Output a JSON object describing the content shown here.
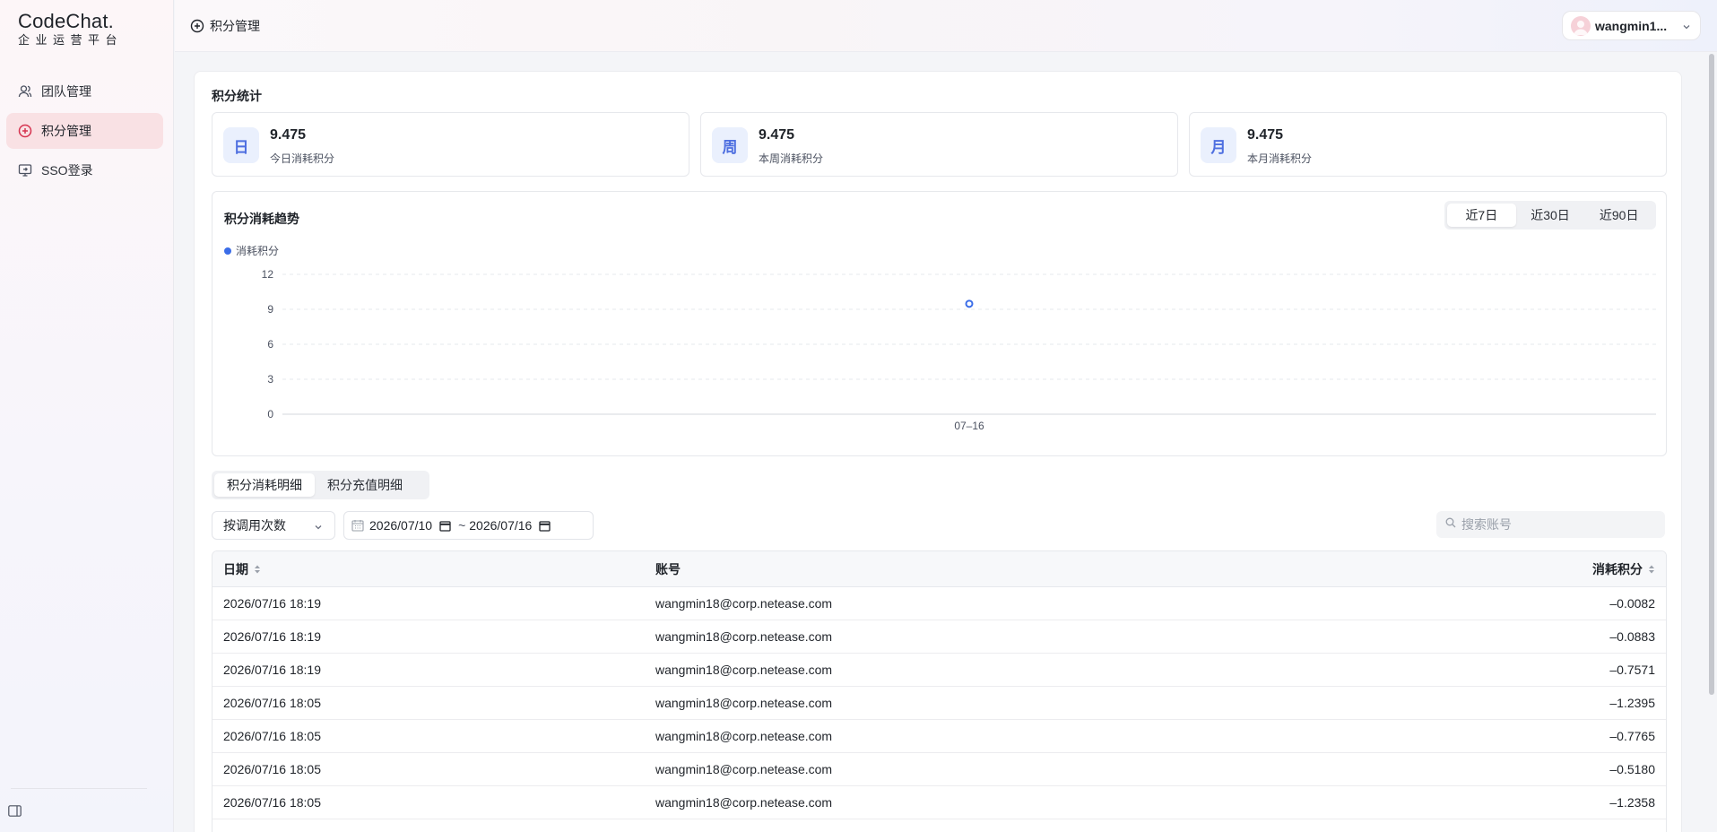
{
  "app": {
    "logo_title": "CodeChat.",
    "logo_subtitle": "企业运营平台"
  },
  "sidebar": {
    "items": [
      {
        "label": "团队管理",
        "icon": "user-icon",
        "active": false
      },
      {
        "label": "积分管理",
        "icon": "plus-circle-icon",
        "active": true
      },
      {
        "label": "SSO登录",
        "icon": "monitor-login-icon",
        "active": false
      }
    ]
  },
  "header": {
    "title": "积分管理",
    "user_name": "wangmin1..."
  },
  "stats": {
    "title": "积分统计",
    "cards": [
      {
        "icon_char": "日",
        "value": "9.475",
        "label": "今日消耗积分"
      },
      {
        "icon_char": "周",
        "value": "9.475",
        "label": "本周消耗积分"
      },
      {
        "icon_char": "月",
        "value": "9.475",
        "label": "本月消耗积分"
      }
    ]
  },
  "trend": {
    "title": "积分消耗趋势",
    "range_tabs": [
      "近7日",
      "近30日",
      "近90日"
    ],
    "active_range": "近7日",
    "legend": "消耗积分"
  },
  "chart_data": {
    "type": "line",
    "categories": [
      "07-16"
    ],
    "series": [
      {
        "name": "消耗积分",
        "values": [
          9.475
        ]
      }
    ],
    "ylim": [
      0,
      12
    ],
    "yticks": [
      "0",
      "3",
      "6",
      "9",
      "12"
    ],
    "xtick_labels": [
      "07–16"
    ],
    "color": "#3b6de8",
    "grid": true,
    "legend_position": "top-left"
  },
  "details": {
    "tabs": [
      "积分消耗明细",
      "积分充值明细"
    ],
    "active_tab": "积分消耗明细",
    "filter_select": "按调用次数",
    "date_start": "2026/07/10",
    "date_sep": "~",
    "date_end": "2026/07/16",
    "search_placeholder": "搜索账号"
  },
  "table": {
    "columns": [
      "日期",
      "账号",
      "消耗积分"
    ],
    "rows": [
      [
        "2026/07/16 18:19",
        "wangmin18@corp.netease.com",
        "–0.0082"
      ],
      [
        "2026/07/16 18:19",
        "wangmin18@corp.netease.com",
        "–0.0883"
      ],
      [
        "2026/07/16 18:19",
        "wangmin18@corp.netease.com",
        "–0.7571"
      ],
      [
        "2026/07/16 18:05",
        "wangmin18@corp.netease.com",
        "–1.2395"
      ],
      [
        "2026/07/16 18:05",
        "wangmin18@corp.netease.com",
        "–0.7765"
      ],
      [
        "2026/07/16 18:05",
        "wangmin18@corp.netease.com",
        "–0.5180"
      ],
      [
        "2026/07/16 18:05",
        "wangmin18@corp.netease.com",
        "–1.2358"
      ]
    ]
  }
}
